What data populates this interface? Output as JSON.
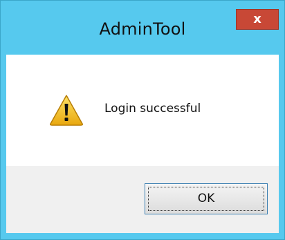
{
  "dialog": {
    "title": "AdminTool",
    "close_label": "x",
    "message": "Login successful",
    "icon": "warning-icon",
    "ok_label": "OK"
  },
  "colors": {
    "frame": "#56c9ee",
    "close_button": "#c84836",
    "button_area": "#f0f0f0",
    "ok_border": "#3c7fb1",
    "warning_yellow": "#f3c21b"
  }
}
